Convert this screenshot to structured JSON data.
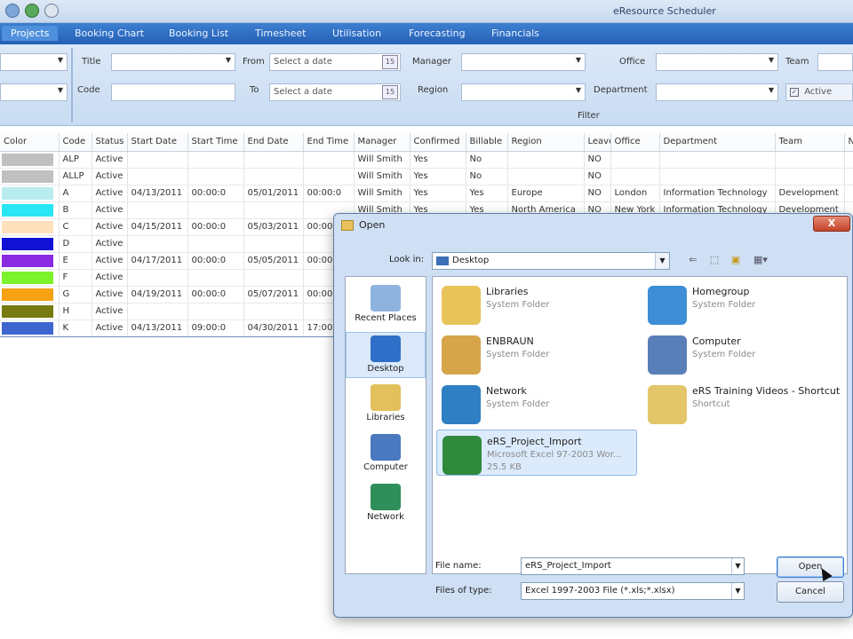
{
  "app": {
    "title": "eResource Scheduler"
  },
  "tabs": [
    {
      "label": "Projects",
      "active": true
    },
    {
      "label": "Booking Chart"
    },
    {
      "label": "Booking List"
    },
    {
      "label": "Timesheet"
    },
    {
      "label": "Utilisation"
    },
    {
      "label": "Forecasting"
    },
    {
      "label": "Financials"
    }
  ],
  "filter": {
    "title_label": "Title",
    "code_label": "Code",
    "from_label": "From",
    "to_label": "To",
    "from_placeholder": "Select a date",
    "to_placeholder": "Select a date",
    "calendar_day": "15",
    "manager_label": "Manager",
    "region_label": "Region",
    "office_label": "Office",
    "department_label": "Department",
    "team_label": "Team",
    "active_label": "Active",
    "active_checked": true,
    "caption": "Filter"
  },
  "grid": {
    "columns": [
      "Color",
      "Code",
      "Status",
      "Start Date",
      "Start Time",
      "End Date",
      "End Time",
      "Manager",
      "Confirmed",
      "Billable",
      "Region",
      "Leave",
      "Office",
      "Department",
      "Team",
      "No"
    ],
    "rows": [
      {
        "color": "#c0c0c0",
        "cells": [
          "ALP",
          "Active",
          "",
          "",
          "",
          "",
          "Will Smith",
          "Yes",
          "No",
          "",
          "NO",
          "",
          "",
          ""
        ]
      },
      {
        "color": "#c0c0c0",
        "cells": [
          "ALLP",
          "Active",
          "",
          "",
          "",
          "",
          "Will Smith",
          "Yes",
          "No",
          "",
          "NO",
          "",
          "",
          ""
        ]
      },
      {
        "color": "#b8ecef",
        "cells": [
          "A",
          "Active",
          "04/13/2011",
          "00:00:0",
          "05/01/2011",
          "00:00:0",
          "Will Smith",
          "Yes",
          "Yes",
          "Europe",
          "NO",
          "London",
          "Information Technology",
          "Development"
        ]
      },
      {
        "color": "#28e6f4",
        "cells": [
          "B",
          "Active",
          "",
          "",
          "",
          "",
          "Will Smith",
          "Yes",
          "Yes",
          "North America",
          "NO",
          "New York",
          "Information Technology",
          "Development"
        ]
      },
      {
        "color": "#fde2bd",
        "cells": [
          "C",
          "Active",
          "04/15/2011",
          "00:00:0",
          "05/03/2011",
          "00:00:0",
          "",
          "",
          "",
          "",
          "",
          "",
          "",
          ""
        ]
      },
      {
        "color": "#1111d6",
        "cells": [
          "D",
          "Active",
          "",
          "",
          "",
          "",
          "",
          "",
          "",
          "",
          "",
          "",
          "",
          ""
        ]
      },
      {
        "color": "#8a2be2",
        "cells": [
          "E",
          "Active",
          "04/17/2011",
          "00:00:0",
          "05/05/2011",
          "00:00:0",
          "",
          "",
          "",
          "",
          "",
          "",
          "",
          ""
        ]
      },
      {
        "color": "#7cf22a",
        "cells": [
          "F",
          "Active",
          "",
          "",
          "",
          "",
          "",
          "",
          "",
          "",
          "",
          "",
          "",
          ""
        ]
      },
      {
        "color": "#f6a212",
        "cells": [
          "G",
          "Active",
          "04/19/2011",
          "00:00:0",
          "05/07/2011",
          "00:00:0",
          "",
          "",
          "",
          "",
          "",
          "",
          "",
          ""
        ]
      },
      {
        "color": "#767a10",
        "cells": [
          "H",
          "Active",
          "",
          "",
          "",
          "",
          "",
          "",
          "",
          "",
          "",
          "",
          "",
          ""
        ]
      },
      {
        "color": "#3e66d0",
        "selected": true,
        "cells": [
          "K",
          "Active",
          "04/13/2011",
          "09:00:0",
          "04/30/2011",
          "17:00",
          "",
          "",
          "",
          "",
          "",
          "",
          "",
          ""
        ]
      }
    ]
  },
  "dialog": {
    "title": "Open",
    "close_label": "X",
    "lookin_label": "Look in:",
    "lookin_value": "Desktop",
    "places": [
      {
        "label": "Recent Places",
        "icon": "recent-places-icon"
      },
      {
        "label": "Desktop",
        "icon": "desktop-icon",
        "selected": true
      },
      {
        "label": "Libraries",
        "icon": "libraries-icon"
      },
      {
        "label": "Computer",
        "icon": "computer-icon"
      },
      {
        "label": "Network",
        "icon": "network-icon"
      }
    ],
    "files": [
      {
        "name": "Libraries",
        "type": "System Folder",
        "icon": "libraries-folder-icon"
      },
      {
        "name": "Homegroup",
        "type": "System Folder",
        "icon": "homegroup-icon"
      },
      {
        "name": "ENBRAUN",
        "type": "System Folder",
        "icon": "user-folder-icon"
      },
      {
        "name": "Computer",
        "type": "System Folder",
        "icon": "computer-icon"
      },
      {
        "name": "Network",
        "type": "System Folder",
        "icon": "network-icon"
      },
      {
        "name": "eRS Training Videos - Shortcut",
        "type": "Shortcut",
        "icon": "shortcut-folder-icon"
      },
      {
        "name": "eRS_Project_Import",
        "type": "Microsoft Excel 97-2003 Wor...",
        "size": "25.5 KB",
        "icon": "excel-file-icon",
        "selected": true
      }
    ],
    "filename_label": "File name:",
    "filename_value": "eRS_Project_Import",
    "filetype_label": "Files of type:",
    "filetype_value": "Excel 1997-2003 File (*.xls;*.xlsx)",
    "open_label": "Open",
    "cancel_label": "Cancel"
  }
}
